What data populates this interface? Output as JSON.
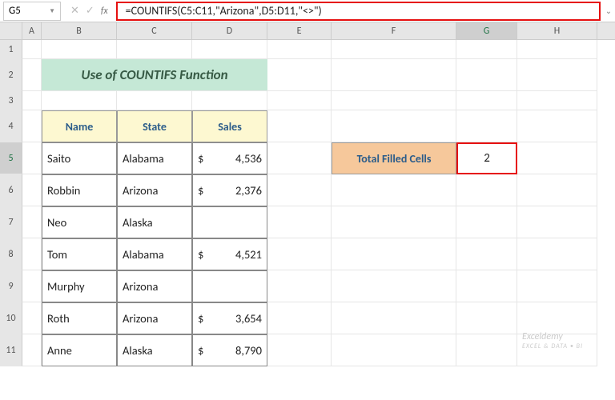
{
  "formulaBar": {
    "nameBox": "G5",
    "formula": "=COUNTIFS(C5:C11,\"Arizona\",D5:D11,\"<>\")"
  },
  "columnHeaders": [
    "A",
    "B",
    "C",
    "D",
    "E",
    "F",
    "G",
    "H"
  ],
  "rowHeaders": [
    "1",
    "2",
    "3",
    "4",
    "5",
    "6",
    "7",
    "8",
    "9",
    "10",
    "11"
  ],
  "activeCell": "G5",
  "title": "Use of COUNTIFS Function",
  "table": {
    "headers": {
      "name": "Name",
      "state": "State",
      "sales": "Sales"
    },
    "rows": [
      {
        "name": "Saito",
        "state": "Alabama",
        "sales": "4,536"
      },
      {
        "name": "Robbin",
        "state": "Arizona",
        "sales": "2,376"
      },
      {
        "name": "Neo",
        "state": "Alaska",
        "sales": ""
      },
      {
        "name": "Tom",
        "state": "Alabama",
        "sales": "4,521"
      },
      {
        "name": "Murphy",
        "state": "Arizona",
        "sales": ""
      },
      {
        "name": "Roth",
        "state": "Arizona",
        "sales": "3,654"
      },
      {
        "name": "Anne",
        "state": "Alaska",
        "sales": "8,790"
      }
    ]
  },
  "summary": {
    "label": "Total Filled Cells",
    "value": "2"
  },
  "currencySymbol": "$",
  "watermark": {
    "main": "Exceldemy",
    "sub": "EXCEL & DATA • BI"
  },
  "chart_data": {
    "type": "table",
    "title": "Use of COUNTIFS Function",
    "columns": [
      "Name",
      "State",
      "Sales"
    ],
    "rows": [
      [
        "Saito",
        "Alabama",
        4536
      ],
      [
        "Robbin",
        "Arizona",
        2376
      ],
      [
        "Neo",
        "Alaska",
        null
      ],
      [
        "Tom",
        "Alabama",
        4521
      ],
      [
        "Murphy",
        "Arizona",
        null
      ],
      [
        "Roth",
        "Arizona",
        3654
      ],
      [
        "Anne",
        "Alaska",
        8790
      ]
    ],
    "summary": {
      "label": "Total Filled Cells",
      "value": 2
    },
    "formula": "=COUNTIFS(C5:C11,\"Arizona\",D5:D11,\"<>\")"
  }
}
